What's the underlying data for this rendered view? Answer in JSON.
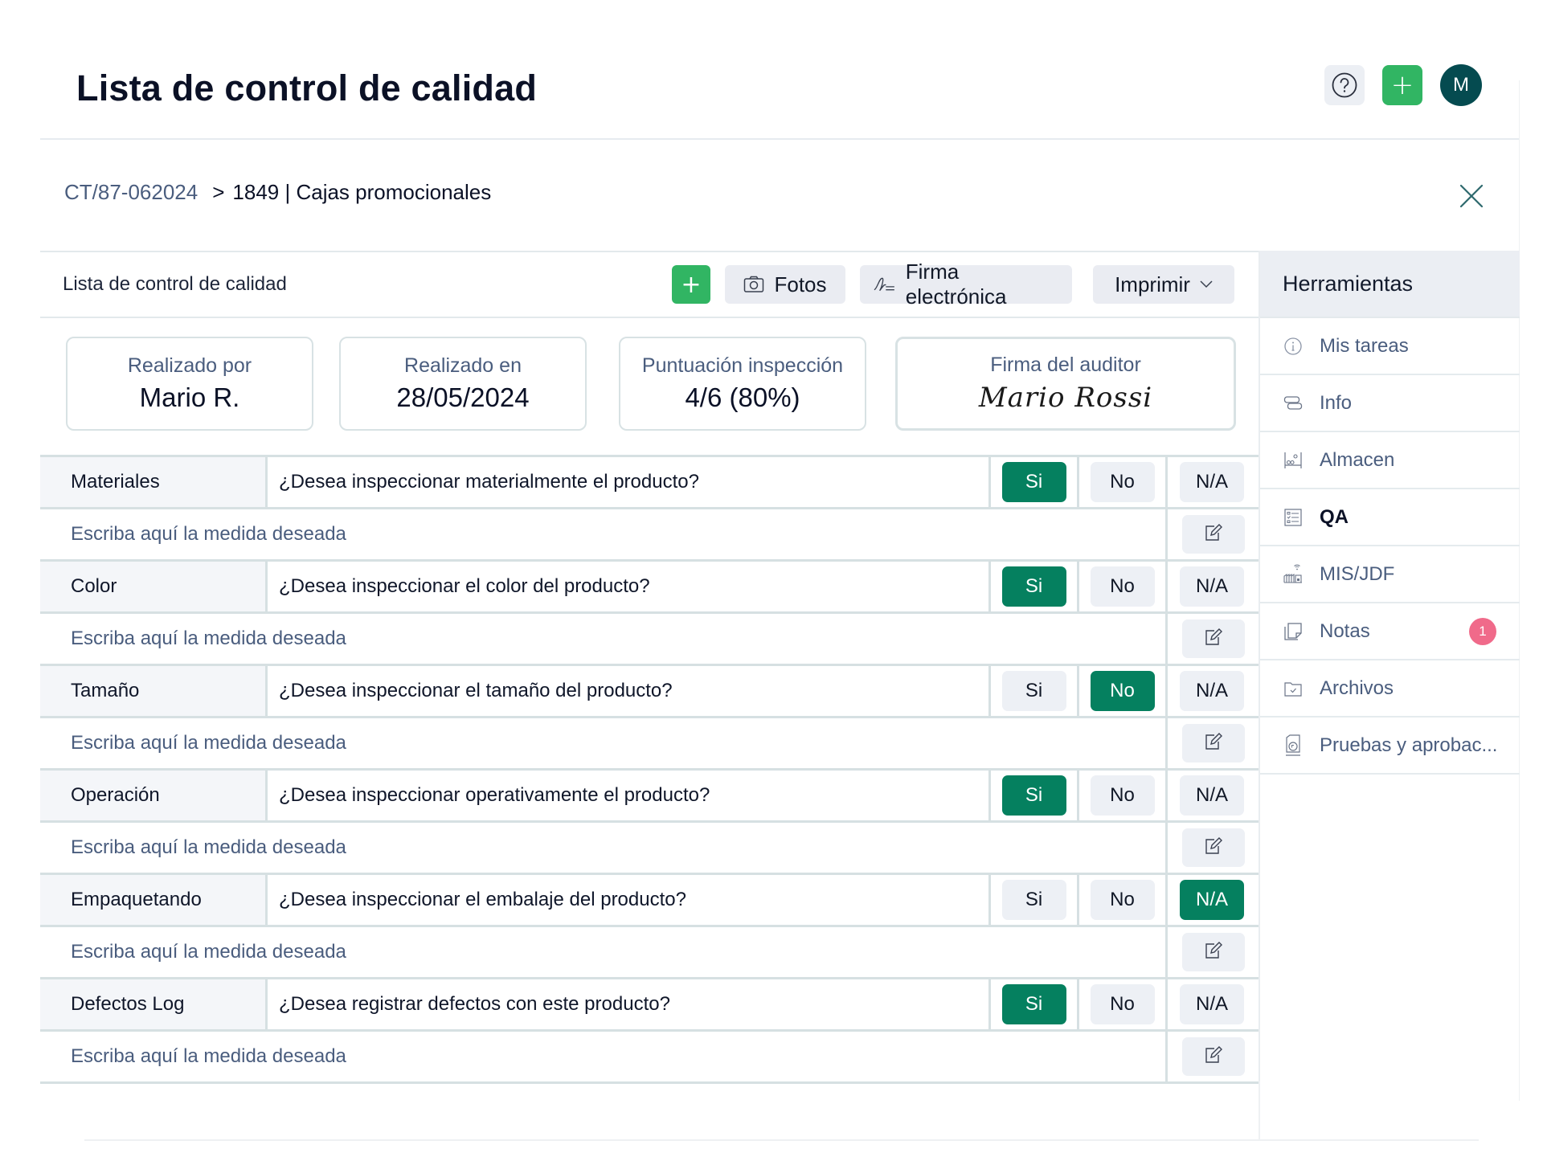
{
  "header": {
    "title": "Lista de control de calidad",
    "help_icon": "question-circle-icon",
    "add_icon": "plus-icon",
    "add_label": "+",
    "avatar_initial": "M"
  },
  "breadcrumb": {
    "parent": "CT/87-062024",
    "separator": ">",
    "current": "1849 | Cajas promocionales",
    "close_icon": "close-icon"
  },
  "toolbar": {
    "title": "Lista de control de calidad",
    "add_label": "+",
    "photos_label": "Fotos",
    "signature_label": "Firma electrónica",
    "print_label": "Imprimir"
  },
  "info_cards": [
    {
      "label": "Realizado por",
      "value": "Mario R."
    },
    {
      "label": "Realizado en",
      "value": "28/05/2024"
    },
    {
      "label": "Puntuación inspección",
      "value": "4/6 (80%)"
    },
    {
      "label": "Firma del auditor",
      "value": "Mario Rossi"
    }
  ],
  "checklist": {
    "options": [
      "Si",
      "No",
      "N/A"
    ],
    "measure_placeholder": "Escriba aquí la medida deseada",
    "items": [
      {
        "label": "Materiales",
        "question": "¿Desea inspeccionar materialmente el producto?",
        "selected": "Si"
      },
      {
        "label": "Color",
        "question": "¿Desea inspeccionar el color del producto?",
        "selected": "Si"
      },
      {
        "label": "Tamaño",
        "question": "¿Desea inspeccionar el tamaño del producto?",
        "selected": "No"
      },
      {
        "label": "Operación",
        "question": "¿Desea inspeccionar operativamente el producto?",
        "selected": "Si"
      },
      {
        "label": "Empaquetando",
        "question": "¿Desea inspeccionar el embalaje del producto?",
        "selected": "N/A"
      },
      {
        "label": "Defectos Log",
        "question": "¿Desea registrar defectos con este producto?",
        "selected": "Si"
      }
    ]
  },
  "sidebar": {
    "title": "Herramientas",
    "items": [
      {
        "label": "Mis tareas",
        "icon": "info-circle-icon"
      },
      {
        "label": "Info",
        "icon": "info-cards-icon"
      },
      {
        "label": "Almacen",
        "icon": "warehouse-icon"
      },
      {
        "label": "QA",
        "icon": "checklist-icon",
        "active": true
      },
      {
        "label": "MIS/JDF",
        "icon": "factory-signal-icon"
      },
      {
        "label": "Notas",
        "icon": "notes-icon",
        "badge": "1"
      },
      {
        "label": "Archivos",
        "icon": "folder-check-icon"
      },
      {
        "label": "Pruebas y aprobac...",
        "icon": "proof-document-icon"
      }
    ]
  },
  "colors": {
    "selected_green": "#05805f",
    "add_green": "#31b563",
    "avatar": "#054b50",
    "badge": "#f06a8a"
  }
}
